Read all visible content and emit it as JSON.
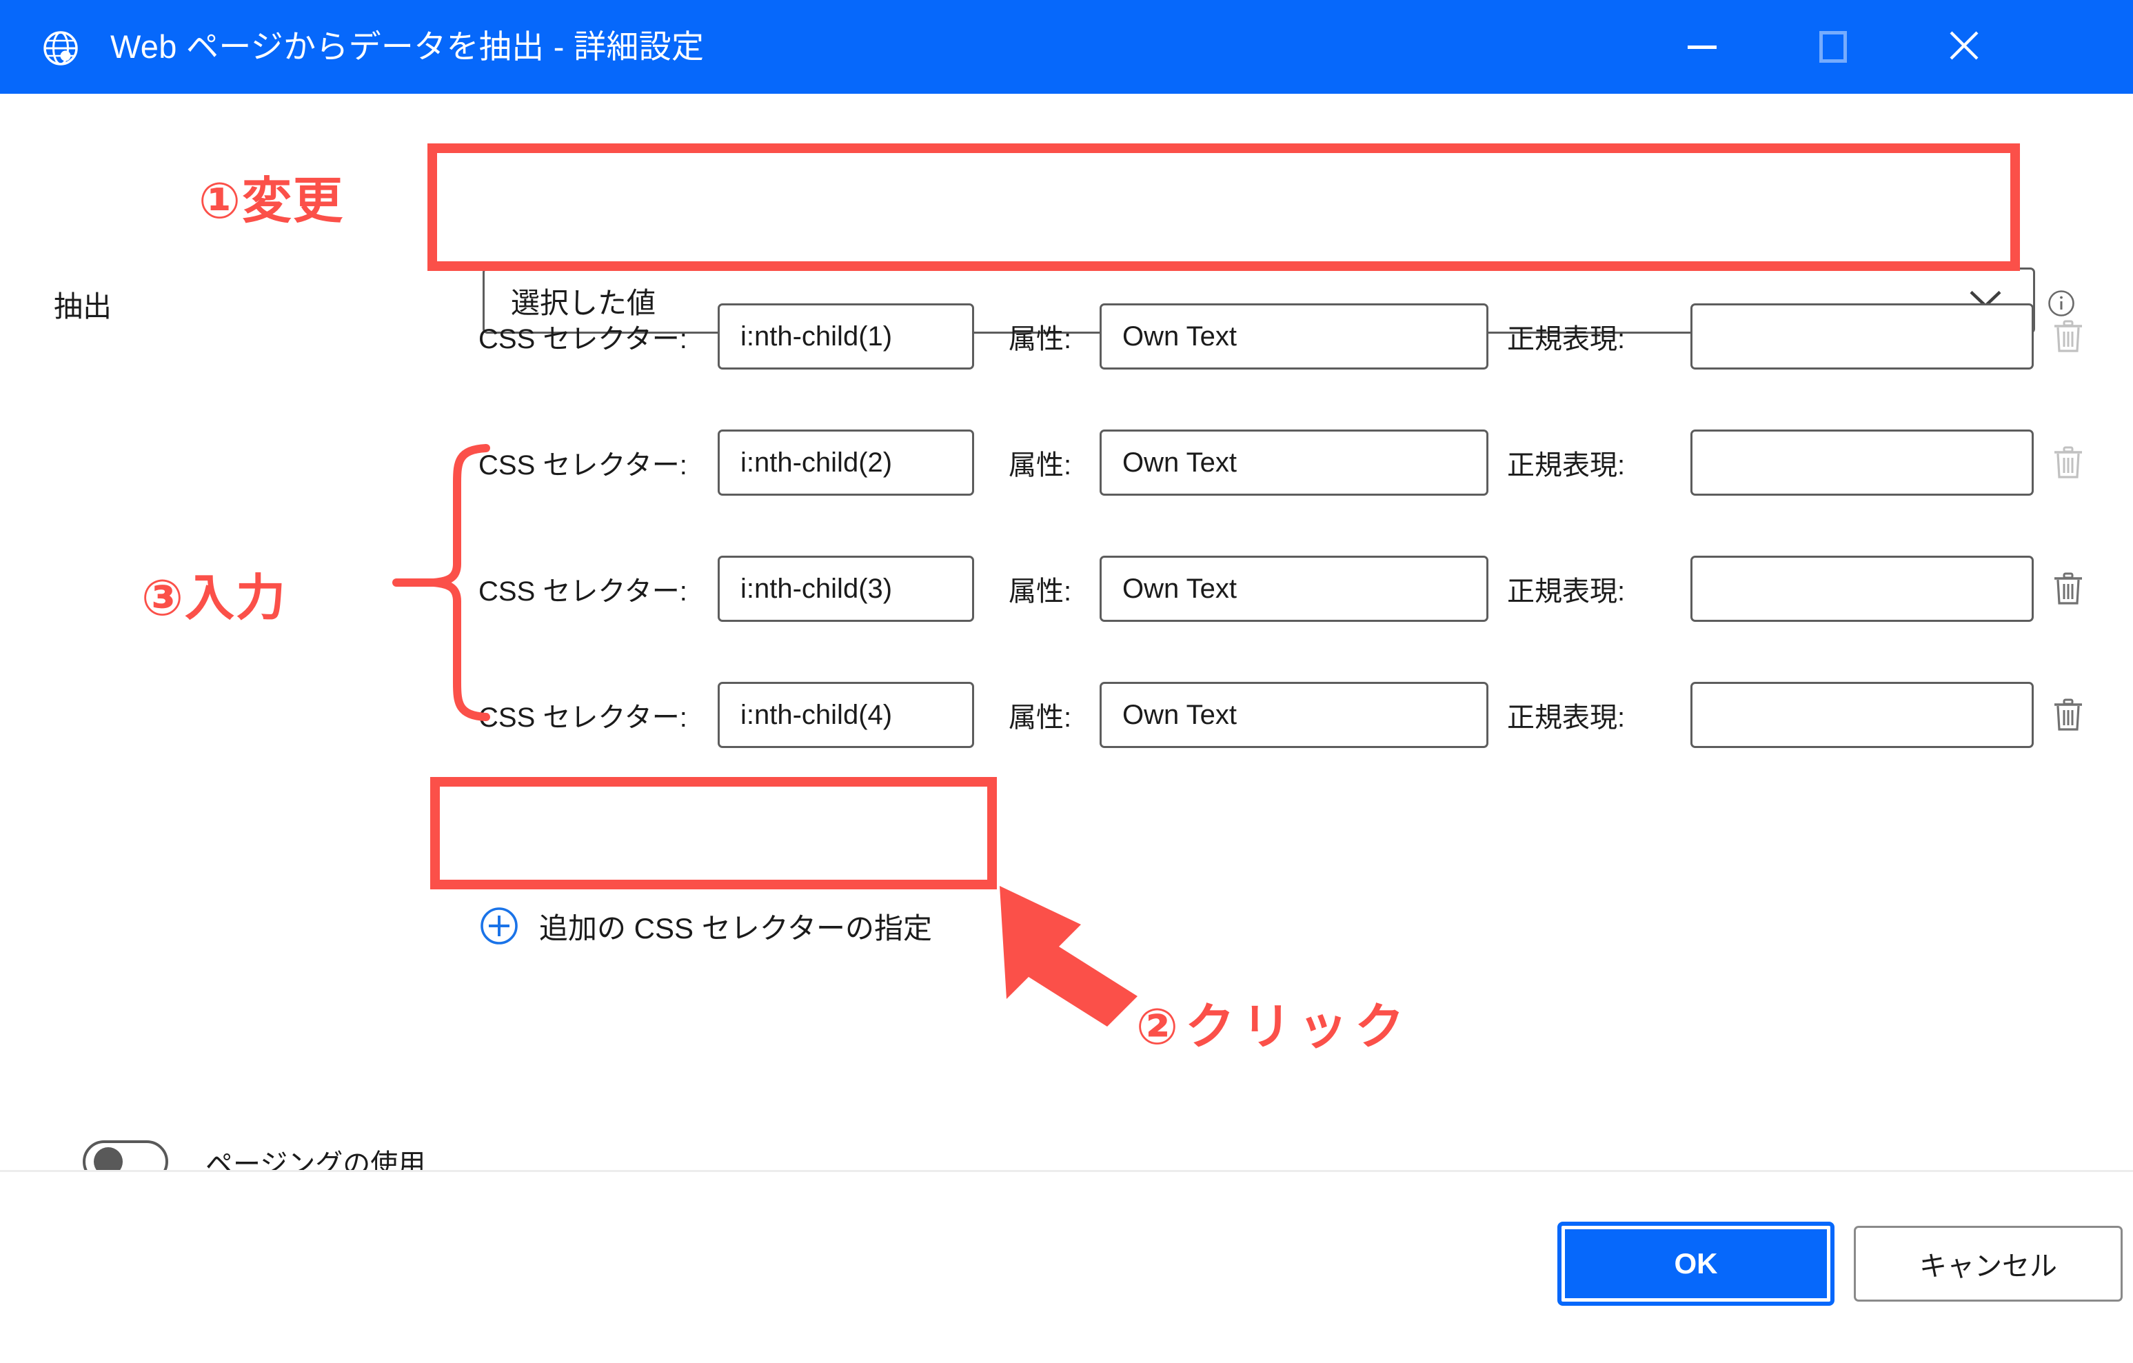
{
  "window": {
    "title": "Web ページからデータを抽出 - 詳細設定",
    "icon": "globe-icon",
    "titlebar_color": "#0668fb",
    "controls": {
      "minimize": "minimize-icon",
      "maximize": "maximize-icon",
      "close": "close-icon"
    }
  },
  "form": {
    "extract_label": "抽出",
    "extract_value": "選択した値",
    "info_icon": "info-icon",
    "chevron_icon": "chevron-down-icon",
    "column_labels": {
      "css": "CSS セレクター:",
      "attr": "属性:",
      "regex": "正規表現:"
    },
    "rows": [
      {
        "css": "i:nth-child(1)",
        "attr": "Own Text",
        "regex": "",
        "delete_icon": "trash-icon",
        "delete_enabled": false
      },
      {
        "css": "i:nth-child(2)",
        "attr": "Own Text",
        "regex": "",
        "delete_icon": "trash-icon",
        "delete_enabled": false
      },
      {
        "css": "i:nth-child(3)",
        "attr": "Own Text",
        "regex": "",
        "delete_icon": "trash-icon",
        "delete_enabled": true
      },
      {
        "css": "i:nth-child(4)",
        "attr": "Own Text",
        "regex": "",
        "delete_icon": "trash-icon",
        "delete_enabled": true
      }
    ],
    "add_selector_label": "追加の CSS セレクターの指定",
    "add_selector_icon": "plus-circle-icon",
    "paging_label": "ページングの使用",
    "paging_enabled": false
  },
  "footer": {
    "ok_label": "OK",
    "cancel_label": "キャンセル"
  },
  "annotations": {
    "color": "#fb5049",
    "step1": "①変更",
    "step2": "②クリック",
    "step3": "③入力"
  }
}
